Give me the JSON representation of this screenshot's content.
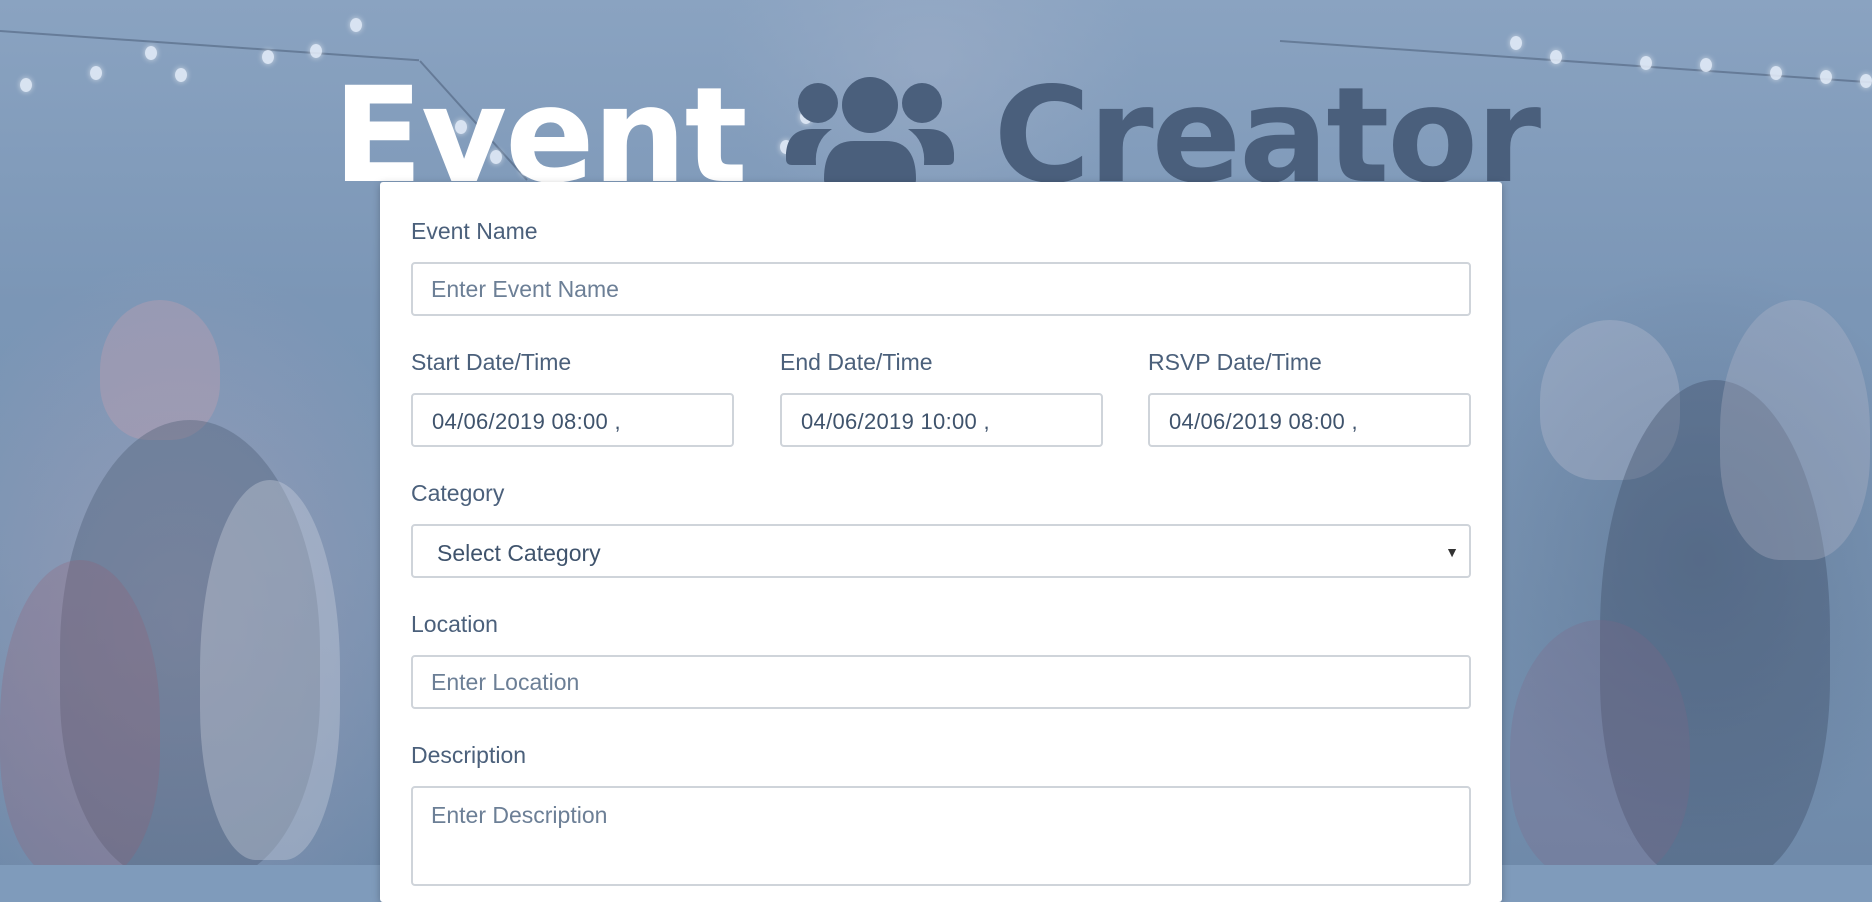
{
  "header": {
    "title_word1": "Event",
    "title_word2": "Creator",
    "icon": "users-icon"
  },
  "form": {
    "event_name": {
      "label": "Event Name",
      "placeholder": "Enter Event Name",
      "value": ""
    },
    "start": {
      "label": "Start Date/Time",
      "value": "04/06/2019 08:00 ,"
    },
    "end": {
      "label": "End Date/Time",
      "value": "04/06/2019 10:00 ,"
    },
    "rsvp": {
      "label": "RSVP Date/Time",
      "value": "04/06/2019 08:00 ,"
    },
    "category": {
      "label": "Category",
      "selected": "Select Category"
    },
    "location": {
      "label": "Location",
      "placeholder": "Enter Location",
      "value": ""
    },
    "description": {
      "label": "Description",
      "placeholder": "Enter Description",
      "value": ""
    }
  },
  "colors": {
    "title_primary": "#ffffff",
    "title_accent": "#4a5f7c",
    "label_text": "#4b607b",
    "card_bg": "#ffffff"
  }
}
